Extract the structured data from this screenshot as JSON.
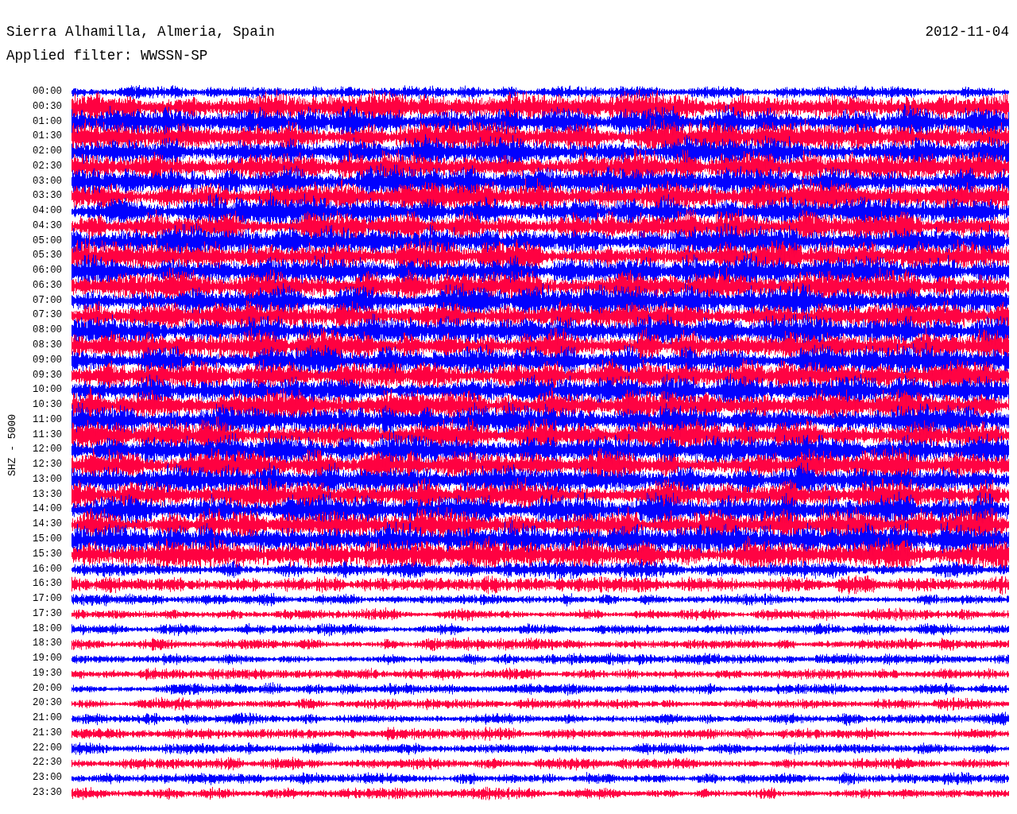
{
  "header": {
    "station": "Sierra Alhamilla, Almeria, Spain",
    "date": "2012-11-04",
    "filter": "Applied filter: WWSSN-SP"
  },
  "axis_label": "SHZ - 5000",
  "time_labels": [
    "00:00",
    "00:30",
    "01:00",
    "01:30",
    "02:00",
    "02:30",
    "03:00",
    "03:30",
    "04:00",
    "04:30",
    "05:00",
    "05:30",
    "06:00",
    "06:30",
    "07:00",
    "07:30",
    "08:00",
    "08:30",
    "09:00",
    "09:30",
    "10:00",
    "10:30",
    "11:00",
    "11:30",
    "12:00",
    "12:30",
    "13:00",
    "13:30",
    "14:00",
    "14:30",
    "15:00",
    "15:30",
    "16:00",
    "16:30",
    "17:00",
    "17:30",
    "18:00",
    "18:30",
    "19:00",
    "19:30",
    "20:00",
    "20:30",
    "21:00",
    "21:30",
    "22:00",
    "22:30",
    "23:00",
    "23:30"
  ]
}
